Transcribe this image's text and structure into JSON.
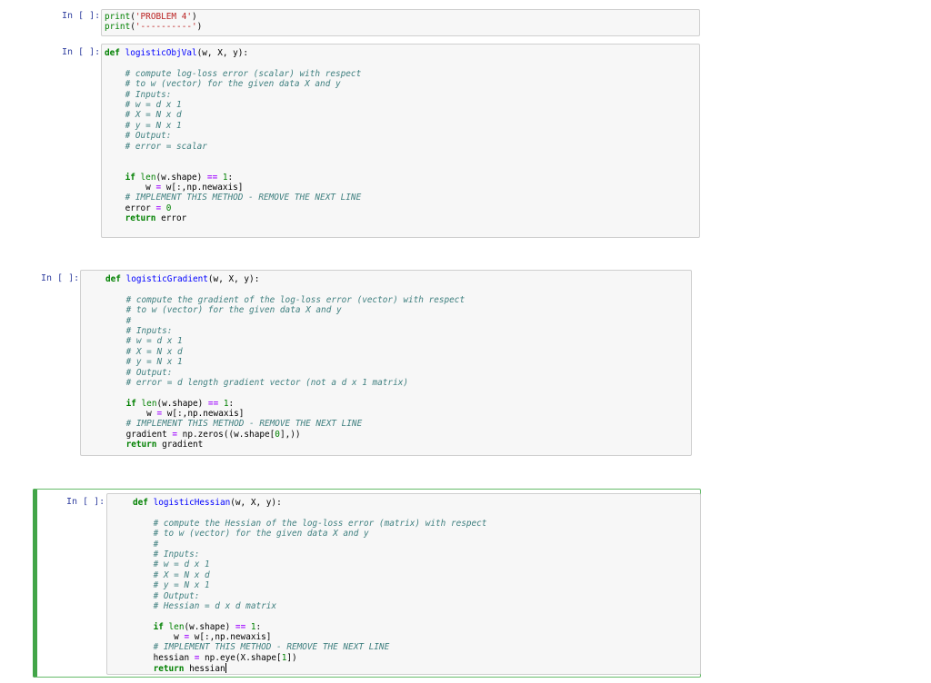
{
  "cells": [
    {
      "prompt": "In [ ]:",
      "lines": [
        [
          {
            "t": "print",
            "c": "bi"
          },
          {
            "t": "(",
            "c": ""
          },
          {
            "t": "'PROBLEM 4'",
            "c": "st"
          },
          {
            "t": ")",
            "c": ""
          }
        ],
        [
          {
            "t": "print",
            "c": "bi"
          },
          {
            "t": "(",
            "c": ""
          },
          {
            "t": "'----------'",
            "c": "st"
          },
          {
            "t": ")",
            "c": ""
          }
        ]
      ]
    },
    {
      "prompt": "In [ ]:",
      "lines": [
        [
          {
            "t": "def",
            "c": "kw"
          },
          {
            "t": " ",
            "c": ""
          },
          {
            "t": "logisticObjVal",
            "c": "fn"
          },
          {
            "t": "(w, X, y):",
            "c": ""
          }
        ],
        [
          {
            "t": "",
            "c": ""
          }
        ],
        [
          {
            "t": "    ",
            "c": ""
          },
          {
            "t": "# compute log-loss error (scalar) with respect",
            "c": "cm"
          }
        ],
        [
          {
            "t": "    ",
            "c": ""
          },
          {
            "t": "# to w (vector) for the given data X and y",
            "c": "cm"
          }
        ],
        [
          {
            "t": "    ",
            "c": ""
          },
          {
            "t": "# Inputs:",
            "c": "cm"
          }
        ],
        [
          {
            "t": "    ",
            "c": ""
          },
          {
            "t": "# w = d x 1",
            "c": "cm"
          }
        ],
        [
          {
            "t": "    ",
            "c": ""
          },
          {
            "t": "# X = N x d",
            "c": "cm"
          }
        ],
        [
          {
            "t": "    ",
            "c": ""
          },
          {
            "t": "# y = N x 1",
            "c": "cm"
          }
        ],
        [
          {
            "t": "    ",
            "c": ""
          },
          {
            "t": "# Output:",
            "c": "cm"
          }
        ],
        [
          {
            "t": "    ",
            "c": ""
          },
          {
            "t": "# error = scalar",
            "c": "cm"
          }
        ],
        [
          {
            "t": "",
            "c": ""
          }
        ],
        [
          {
            "t": "",
            "c": ""
          }
        ],
        [
          {
            "t": "    ",
            "c": ""
          },
          {
            "t": "if",
            "c": "kw"
          },
          {
            "t": " ",
            "c": ""
          },
          {
            "t": "len",
            "c": "bi"
          },
          {
            "t": "(w.shape) ",
            "c": ""
          },
          {
            "t": "==",
            "c": "op"
          },
          {
            "t": " ",
            "c": ""
          },
          {
            "t": "1",
            "c": "nm"
          },
          {
            "t": ":",
            "c": ""
          }
        ],
        [
          {
            "t": "        w ",
            "c": ""
          },
          {
            "t": "=",
            "c": "op"
          },
          {
            "t": " w[:,np.newaxis]",
            "c": ""
          }
        ],
        [
          {
            "t": "    ",
            "c": ""
          },
          {
            "t": "# IMPLEMENT THIS METHOD - REMOVE THE NEXT LINE",
            "c": "cm"
          }
        ],
        [
          {
            "t": "    error ",
            "c": ""
          },
          {
            "t": "=",
            "c": "op"
          },
          {
            "t": " ",
            "c": ""
          },
          {
            "t": "0",
            "c": "nm"
          }
        ],
        [
          {
            "t": "    ",
            "c": ""
          },
          {
            "t": "return",
            "c": "kw"
          },
          {
            "t": " error",
            "c": ""
          }
        ]
      ]
    },
    {
      "prompt": "In [ ]:",
      "lines": [
        [
          {
            "t": "def",
            "c": "kw"
          },
          {
            "t": " ",
            "c": ""
          },
          {
            "t": "logisticGradient",
            "c": "fn"
          },
          {
            "t": "(w, X, y):",
            "c": ""
          }
        ],
        [
          {
            "t": "",
            "c": ""
          }
        ],
        [
          {
            "t": "    ",
            "c": ""
          },
          {
            "t": "# compute the gradient of the log-loss error (vector) with respect",
            "c": "cm"
          }
        ],
        [
          {
            "t": "    ",
            "c": ""
          },
          {
            "t": "# to w (vector) for the given data X and y",
            "c": "cm"
          }
        ],
        [
          {
            "t": "    ",
            "c": ""
          },
          {
            "t": "#",
            "c": "cm"
          }
        ],
        [
          {
            "t": "    ",
            "c": ""
          },
          {
            "t": "# Inputs:",
            "c": "cm"
          }
        ],
        [
          {
            "t": "    ",
            "c": ""
          },
          {
            "t": "# w = d x 1",
            "c": "cm"
          }
        ],
        [
          {
            "t": "    ",
            "c": ""
          },
          {
            "t": "# X = N x d",
            "c": "cm"
          }
        ],
        [
          {
            "t": "    ",
            "c": ""
          },
          {
            "t": "# y = N x 1",
            "c": "cm"
          }
        ],
        [
          {
            "t": "    ",
            "c": ""
          },
          {
            "t": "# Output:",
            "c": "cm"
          }
        ],
        [
          {
            "t": "    ",
            "c": ""
          },
          {
            "t": "# error = d length gradient vector (not a d x 1 matrix)",
            "c": "cm"
          }
        ],
        [
          {
            "t": "",
            "c": ""
          }
        ],
        [
          {
            "t": "    ",
            "c": ""
          },
          {
            "t": "if",
            "c": "kw"
          },
          {
            "t": " ",
            "c": ""
          },
          {
            "t": "len",
            "c": "bi"
          },
          {
            "t": "(w.shape) ",
            "c": ""
          },
          {
            "t": "==",
            "c": "op"
          },
          {
            "t": " ",
            "c": ""
          },
          {
            "t": "1",
            "c": "nm"
          },
          {
            "t": ":",
            "c": ""
          }
        ],
        [
          {
            "t": "        w ",
            "c": ""
          },
          {
            "t": "=",
            "c": "op"
          },
          {
            "t": " w[:,np.newaxis]",
            "c": ""
          }
        ],
        [
          {
            "t": "    ",
            "c": ""
          },
          {
            "t": "# IMPLEMENT THIS METHOD - REMOVE THE NEXT LINE",
            "c": "cm"
          }
        ],
        [
          {
            "t": "    gradient ",
            "c": ""
          },
          {
            "t": "=",
            "c": "op"
          },
          {
            "t": " np.zeros((w.shape[",
            "c": ""
          },
          {
            "t": "0",
            "c": "nm"
          },
          {
            "t": "],))",
            "c": ""
          }
        ],
        [
          {
            "t": "    ",
            "c": ""
          },
          {
            "t": "return",
            "c": "kw"
          },
          {
            "t": " gradient",
            "c": ""
          }
        ]
      ]
    },
    {
      "prompt": "In [ ]:",
      "lines": [
        [
          {
            "t": "def",
            "c": "kw"
          },
          {
            "t": " ",
            "c": ""
          },
          {
            "t": "logisticHessian",
            "c": "fn"
          },
          {
            "t": "(w, X, y):",
            "c": ""
          }
        ],
        [
          {
            "t": "",
            "c": ""
          }
        ],
        [
          {
            "t": "    ",
            "c": ""
          },
          {
            "t": "# compute the Hessian of the log-loss error (matrix) with respect",
            "c": "cm"
          }
        ],
        [
          {
            "t": "    ",
            "c": ""
          },
          {
            "t": "# to w (vector) for the given data X and y",
            "c": "cm"
          }
        ],
        [
          {
            "t": "    ",
            "c": ""
          },
          {
            "t": "#",
            "c": "cm"
          }
        ],
        [
          {
            "t": "    ",
            "c": ""
          },
          {
            "t": "# Inputs:",
            "c": "cm"
          }
        ],
        [
          {
            "t": "    ",
            "c": ""
          },
          {
            "t": "# w = d x 1",
            "c": "cm"
          }
        ],
        [
          {
            "t": "    ",
            "c": ""
          },
          {
            "t": "# X = N x d",
            "c": "cm"
          }
        ],
        [
          {
            "t": "    ",
            "c": ""
          },
          {
            "t": "# y = N x 1",
            "c": "cm"
          }
        ],
        [
          {
            "t": "    ",
            "c": ""
          },
          {
            "t": "# Output:",
            "c": "cm"
          }
        ],
        [
          {
            "t": "    ",
            "c": ""
          },
          {
            "t": "# Hessian = d x d matrix",
            "c": "cm"
          }
        ],
        [
          {
            "t": "",
            "c": ""
          }
        ],
        [
          {
            "t": "    ",
            "c": ""
          },
          {
            "t": "if",
            "c": "kw"
          },
          {
            "t": " ",
            "c": ""
          },
          {
            "t": "len",
            "c": "bi"
          },
          {
            "t": "(w.shape) ",
            "c": ""
          },
          {
            "t": "==",
            "c": "op"
          },
          {
            "t": " ",
            "c": ""
          },
          {
            "t": "1",
            "c": "nm"
          },
          {
            "t": ":",
            "c": ""
          }
        ],
        [
          {
            "t": "        w ",
            "c": ""
          },
          {
            "t": "=",
            "c": "op"
          },
          {
            "t": " w[:,np.newaxis]",
            "c": ""
          }
        ],
        [
          {
            "t": "    ",
            "c": ""
          },
          {
            "t": "# IMPLEMENT THIS METHOD - REMOVE THE NEXT LINE",
            "c": "cm"
          }
        ],
        [
          {
            "t": "    hessian ",
            "c": ""
          },
          {
            "t": "=",
            "c": "op"
          },
          {
            "t": " np.eye(X.shape[",
            "c": ""
          },
          {
            "t": "1",
            "c": "nm"
          },
          {
            "t": "])",
            "c": ""
          }
        ],
        [
          {
            "t": "    ",
            "c": ""
          },
          {
            "t": "return",
            "c": "kw"
          },
          {
            "t": " hessian",
            "c": ""
          }
        ]
      ]
    }
  ],
  "selected_cell_index": 3
}
